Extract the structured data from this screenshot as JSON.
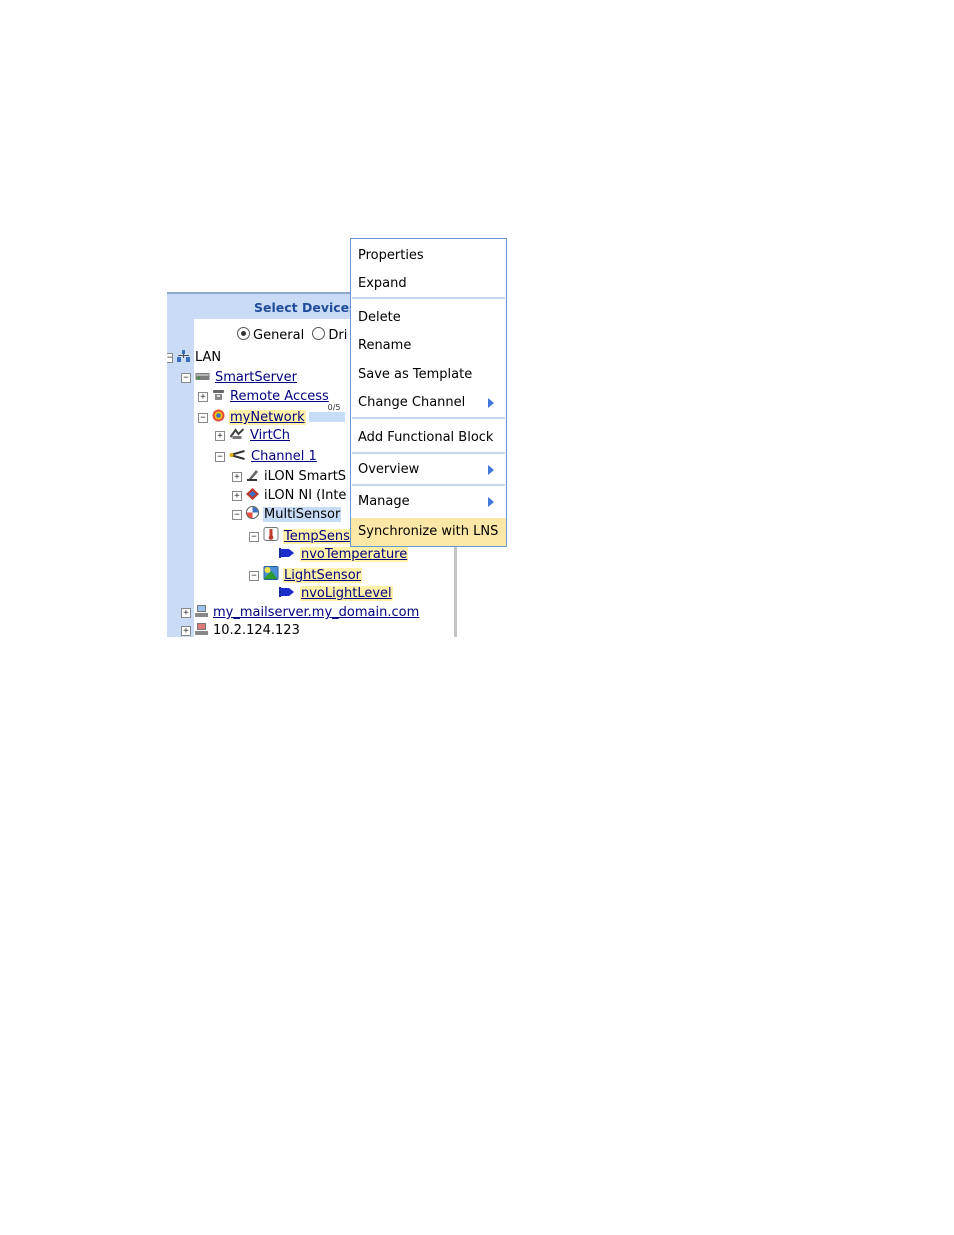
{
  "panel": {
    "title": "Select Devices",
    "mode_options": [
      "General",
      "Dri"
    ],
    "selected_mode": "General"
  },
  "tree": {
    "lan": "LAN",
    "smartserver": "SmartServer",
    "remote_access": "Remote Access",
    "mynetwork": "myNetwork",
    "mynetwork_progress": "0/5",
    "virtch": "VirtCh",
    "channel1": "Channel 1",
    "ilon_smartserver": "iLON SmartS",
    "ilon_ni": "iLON NI (Inte",
    "multisensor": "MultiSensor",
    "tempsensor": "TempSens",
    "nvo_temperature": "nvoTemperature",
    "lightsensor": "LightSensor",
    "nvo_lightlevel": "nvoLightLevel",
    "mailserver": "my_mailserver.my_domain.com",
    "ip_node": "10.2.124.123"
  },
  "context_menu": {
    "items": [
      {
        "label": "Properties"
      },
      {
        "label": "Expand"
      },
      {
        "label": "Delete"
      },
      {
        "label": "Rename"
      },
      {
        "label": "Save as Template"
      },
      {
        "label": "Change Channel",
        "submenu": true
      },
      {
        "label": "Add Functional Block"
      },
      {
        "label": "Overview",
        "submenu": true
      },
      {
        "label": "Manage",
        "submenu": true
      },
      {
        "label": "Synchronize with LNS",
        "highlighted": true
      }
    ],
    "highlight_color": "#fce8a6",
    "border_color": "#6b96d4"
  }
}
